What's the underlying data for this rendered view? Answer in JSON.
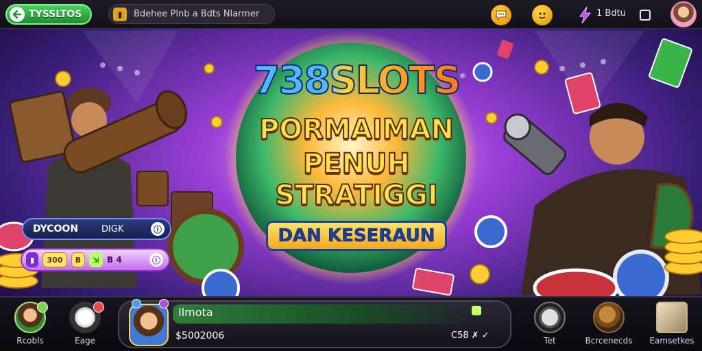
{
  "topbar": {
    "back_label": "TYSSLTOS",
    "search_text": "Bdehee Plnb a Bdts Nlarmer",
    "count_label": "1 Bdtu"
  },
  "hero": {
    "brand": "738SLOTS",
    "registered": "®",
    "line1": "PORMAIMAN",
    "line2": "PENUH STRATIGGI",
    "subtitle": "DAN KESERAUN"
  },
  "left_widgets": {
    "pill_a_label": "DYCOON",
    "pill_a_sub": "DIGK",
    "pill_a_icon": "ⓘ",
    "pill_b_chip1": "▮",
    "pill_b_chip2": "300",
    "pill_b_chip3": "B",
    "pill_b_chip4": "⇲",
    "pill_b_chip5": "B 4",
    "pill_b_icon": "ⓘ"
  },
  "bottom_nav": {
    "profile_label": "Rcobls",
    "bag_label": "Eage",
    "tet_label": "Tet",
    "gold_label": "Bcrcenecds",
    "sword_label": "Eamsetkes"
  },
  "player": {
    "name": "Ilmota",
    "balance": "$5002006",
    "stats": "C58  ✗  ✓"
  },
  "colors": {
    "accent_green": "#44d35a",
    "gold": "#ffd23a",
    "brand_blue": "#4fb8ff",
    "purple": "#c56bf0"
  },
  "icons": {
    "back": "back-arrow-icon",
    "search": "ticket-icon",
    "chat": "chat-bubble-icon",
    "mascot": "mascot-face-icon",
    "bolt": "lightning-icon",
    "frame": "frame-icon"
  }
}
